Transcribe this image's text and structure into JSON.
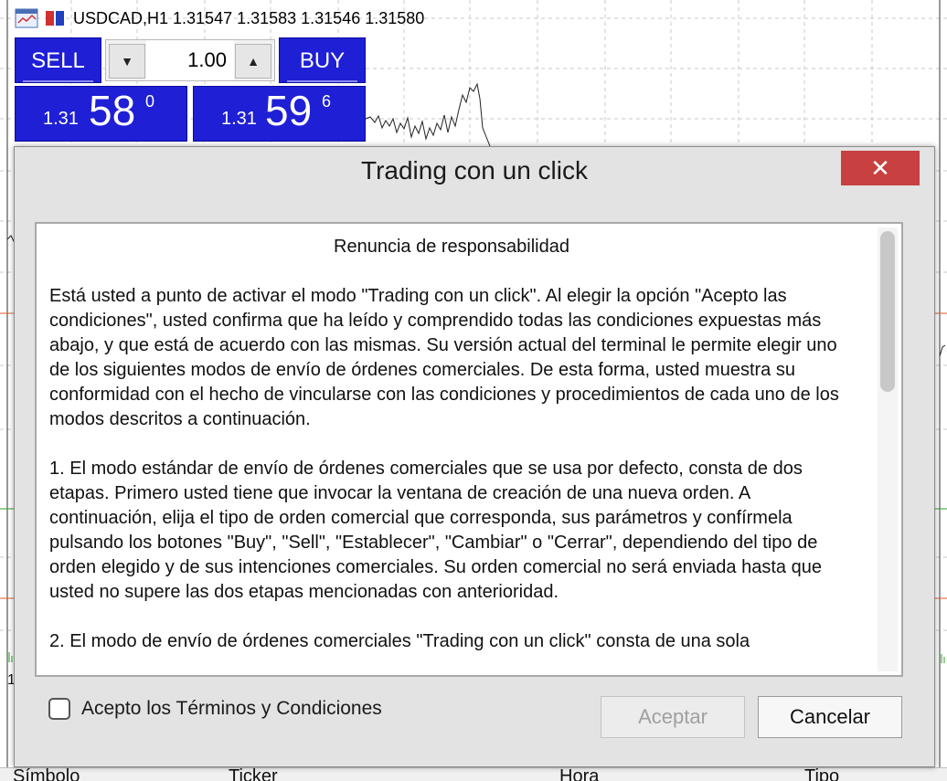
{
  "chart": {
    "symbol_line": "USDCAD,H1  1.31547 1.31583 1.31546 1.31580",
    "axis_fragment_left": "1"
  },
  "one_click": {
    "sell_label": "SELL",
    "buy_label": "BUY",
    "lot": "1.00",
    "sell_price_prefix": "1.31",
    "sell_price_big": "58",
    "sell_price_sup": "0",
    "buy_price_prefix": "1.31",
    "buy_price_big": "59",
    "buy_price_sup": "6",
    "colors": {
      "panel": "#1f1fd6",
      "lot_bg": "#f2f2f2"
    }
  },
  "dialog": {
    "title": "Trading con un click",
    "close_icon": "close-icon",
    "heading": "Renuncia de responsabilidad",
    "paragraphs": [
      "Está usted a punto de activar el modo \"Trading con un click\". Al elegir la opción \"Acepto las condiciones\", usted confirma que ha leído y comprendido todas las condiciones expuestas más abajo, y que está de acuerdo con las mismas. Su versión actual del terminal le permite elegir uno de los siguientes modos de envío de órdenes comerciales. De esta forma, usted muestra su conformidad con el hecho de vincularse con las condiciones y procedimientos de cada uno de los modos descritos a continuación.",
      "1. El modo estándar de envío de órdenes comerciales que se usa por defecto, consta de dos etapas. Primero usted tiene que invocar la ventana de creación de una nueva orden. A continuación, elija el tipo de orden comercial que corresponda, sus parámetros y confírmela pulsando los botones \"Buy\", \"Sell\", \"Establecer\", \"Cambiar\" o \"Cerrar\", dependiendo del tipo de orden elegido y de sus intenciones comerciales. Su orden comercial no será enviada hasta que usted no supere las dos etapas mencionadas con anterioridad.",
      "2. El modo de envío de órdenes comerciales \"Trading con un click\" consta de una sola"
    ],
    "checkbox_label": "Acepto los Términos y Condiciones",
    "accept_label": "Aceptar",
    "cancel_label": "Cancelar",
    "close_color": "#c84040"
  },
  "bottom_columns": {
    "symbol": "Símbolo",
    "ticker": "Ticker",
    "time": "Hora",
    "type": "Tipo"
  }
}
